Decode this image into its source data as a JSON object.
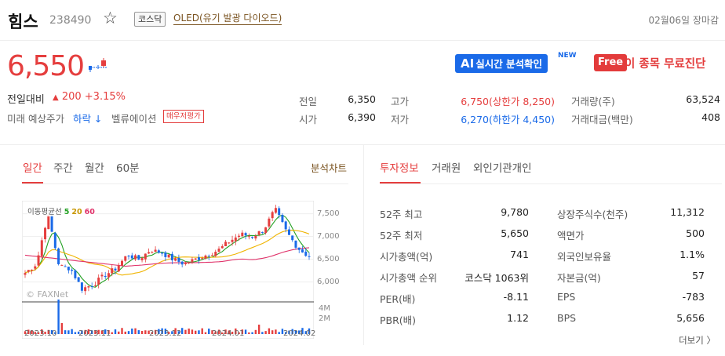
{
  "header": {
    "name": "힘스",
    "code": "238490",
    "market": "코스닥",
    "sector": "OLED(유기 발광 다이오드)",
    "status": "02월06일 장마감"
  },
  "price": {
    "current": "6,550",
    "change_label": "전일대비",
    "change_arrow": "▲",
    "change_value": "200 +3.15%",
    "future_label": "미래 예상주가",
    "future_value": "하락 ↓",
    "valuation_label": "벨류에이션",
    "valuation_badge": "매우저평가"
  },
  "promos": {
    "ai_prefix": "AI",
    "ai_label": "실시간 분석확인",
    "new_tag": "NEW",
    "free_badge": "Free",
    "free_label": "이 종목 무료진단"
  },
  "quote": {
    "prev_close_label": "전일",
    "prev_close": "6,350",
    "open_label": "시가",
    "open": "6,390",
    "high_label": "고가",
    "high": "6,750(상한가 8,250)",
    "low_label": "저가",
    "low": "6,270(하한가 4,450)",
    "volume_label": "거래량(주)",
    "volume": "63,524",
    "value_label": "거래대금(백만)",
    "value": "408"
  },
  "chart_tabs": [
    "일간",
    "주간",
    "월간",
    "60분"
  ],
  "analysis_chart": "분석차트",
  "info_tabs": [
    "투자정보",
    "거래원",
    "외인기관개인"
  ],
  "chart": {
    "legend_prefix": "이동평균선",
    "ma5": "5",
    "ma20": "20",
    "ma60": "60",
    "watermark": "© FAXNet",
    "y_ticks": [
      "7,500",
      "7,000",
      "6,500",
      "6,000"
    ],
    "vol_ticks": [
      "4M",
      "2M"
    ],
    "x_ticks": [
      "2023.10",
      "2023.11",
      "2023.12",
      "2024.01",
      "2024.02"
    ],
    "colors": {
      "up": "#e53e3e",
      "down": "#1a6ae8",
      "ma5": "#22a022",
      "ma20": "#f0b400",
      "ma60": "#e0336a"
    }
  },
  "chart_data": {
    "type": "candlestick",
    "x_range": [
      "2023.10",
      "2024.02"
    ],
    "ylim": [
      5650,
      7700
    ],
    "close_path": [
      6200,
      6400,
      7500,
      6350,
      6300,
      5850,
      5950,
      6150,
      6300,
      6600,
      6500,
      6700,
      6650,
      6500,
      6400,
      6500,
      6600,
      6700,
      6900,
      7050,
      7000,
      7150,
      7600,
      7100,
      6750,
      6550
    ]
  },
  "info": {
    "left": [
      {
        "label": "52주 최고",
        "value": "9,780"
      },
      {
        "label": "52주 최저",
        "value": "5,650"
      },
      {
        "label": "시가총액(억)",
        "value": "741"
      },
      {
        "label": "시가총액 순위",
        "value": "코스닥 1063위"
      },
      {
        "label": "PER(배)",
        "value": "-8.11"
      },
      {
        "label": "PBR(배)",
        "value": "1.12"
      }
    ],
    "right": [
      {
        "label": "상장주식수(천주)",
        "value": "11,312"
      },
      {
        "label": "액면가",
        "value": "500"
      },
      {
        "label": "외국인보유율",
        "value": "1.1%"
      },
      {
        "label": "자본금(억)",
        "value": "57"
      },
      {
        "label": "EPS",
        "value": "-783"
      },
      {
        "label": "BPS",
        "value": "5,656"
      }
    ],
    "more": "더보기 〉"
  }
}
